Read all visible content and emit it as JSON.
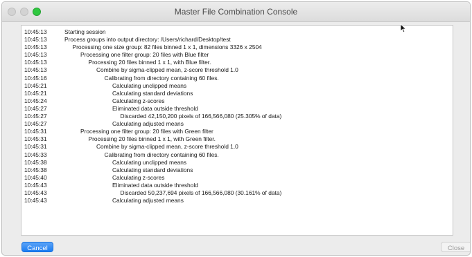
{
  "window": {
    "title": "Master File Combination Console"
  },
  "log": [
    {
      "time": "10:45:13",
      "indent": 0,
      "message": "Starting session"
    },
    {
      "time": "10:45:13",
      "indent": 0,
      "message": "Process groups into output directory: /Users/richard/Desktop/test"
    },
    {
      "time": "10:45:13",
      "indent": 1,
      "message": "Processing one size group: 82 files binned 1 x 1, dimensions 3326 x 2504"
    },
    {
      "time": "10:45:13",
      "indent": 2,
      "message": "Processing one filter group: 20 files with Blue filter"
    },
    {
      "time": "10:45:13",
      "indent": 3,
      "message": "Processing 20 files binned 1 x 1, with Blue filter."
    },
    {
      "time": "10:45:13",
      "indent": 4,
      "message": "Combine by sigma-clipped mean, z-score threshold 1.0"
    },
    {
      "time": "10:45:16",
      "indent": 5,
      "message": "Calibrating from directory containing 60 files."
    },
    {
      "time": "10:45:21",
      "indent": 6,
      "message": "Calculating unclipped means"
    },
    {
      "time": "10:45:21",
      "indent": 6,
      "message": "Calculating standard deviations"
    },
    {
      "time": "10:45:24",
      "indent": 6,
      "message": "Calculating z-scores"
    },
    {
      "time": "10:45:27",
      "indent": 6,
      "message": "Eliminated data outside threshold"
    },
    {
      "time": "10:45:27",
      "indent": 7,
      "message": "Discarded 42,150,200 pixels of 166,566,080 (25.305% of data)"
    },
    {
      "time": "10:45:27",
      "indent": 6,
      "message": "Calculating adjusted means"
    },
    {
      "time": "10:45:31",
      "indent": 2,
      "message": "Processing one filter group: 20 files with Green filter"
    },
    {
      "time": "10:45:31",
      "indent": 3,
      "message": "Processing 20 files binned 1 x 1, with Green filter."
    },
    {
      "time": "10:45:31",
      "indent": 4,
      "message": "Combine by sigma-clipped mean, z-score threshold 1.0"
    },
    {
      "time": "10:45:33",
      "indent": 5,
      "message": "Calibrating from directory containing 60 files."
    },
    {
      "time": "10:45:38",
      "indent": 6,
      "message": "Calculating unclipped means"
    },
    {
      "time": "10:45:38",
      "indent": 6,
      "message": "Calculating standard deviations"
    },
    {
      "time": "10:45:40",
      "indent": 6,
      "message": "Calculating z-scores"
    },
    {
      "time": "10:45:43",
      "indent": 6,
      "message": "Eliminated data outside threshold"
    },
    {
      "time": "10:45:43",
      "indent": 7,
      "message": "Discarded 50,237,694 pixels of 166,566,080 (30.161% of data)"
    },
    {
      "time": "10:45:43",
      "indent": 6,
      "message": "Calculating adjusted means"
    }
  ],
  "buttons": {
    "cancel_label": "Cancel",
    "close_label": "Close"
  },
  "colors": {
    "accent": "#1a7cf2",
    "zoom_button": "#2fc840"
  },
  "icons": {
    "close": "close-icon",
    "minimize": "minimize-icon",
    "zoom": "zoom-icon",
    "pointer": "mouse-pointer-icon"
  }
}
